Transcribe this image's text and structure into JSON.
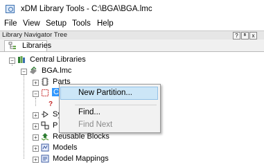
{
  "window": {
    "title": "xDM Library Tools - C:\\BGA\\BGA.lmc"
  },
  "menu": [
    "File",
    "View",
    "Setup",
    "Tools",
    "Help"
  ],
  "panel": {
    "title": "Library Navigator Tree",
    "pin": "ᴮ",
    "restore": "?",
    "close": "x"
  },
  "tab": {
    "label": "Libraries"
  },
  "tree": {
    "central": "Central Libraries",
    "library": "BGA.lmc",
    "items": {
      "parts": "Parts",
      "partitions": "C",
      "symbols": "Sy",
      "padstacks": "P",
      "reusable": "Reusable Blocks",
      "models": "Models",
      "mappings": "Model Mappings"
    }
  },
  "context_menu": {
    "new_partition": "New Partition...",
    "find": "Find...",
    "find_next": "Find Next"
  }
}
